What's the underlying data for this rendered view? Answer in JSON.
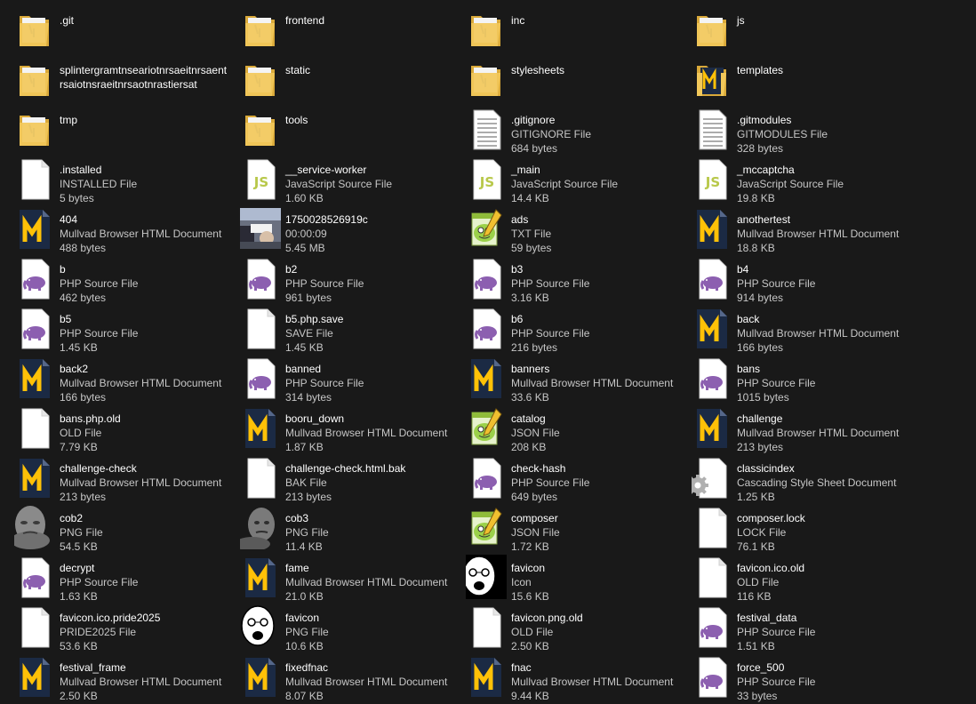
{
  "window": {
    "view": "Tiles"
  },
  "colors": {
    "background": "#191919",
    "folder": "#e8c05a",
    "mullvad_bg": "#1b2a44",
    "mullvad_m": "#ffc107",
    "php_purple": "#8c5fb0",
    "js_green": "#b8c84a"
  },
  "items": [
    {
      "name": ".git",
      "type": "",
      "size": "",
      "icon": "folder-icon",
      "kind": "folder"
    },
    {
      "name": "frontend",
      "type": "",
      "size": "",
      "icon": "folder-icon",
      "kind": "folder"
    },
    {
      "name": "inc",
      "type": "",
      "size": "",
      "icon": "folder-icon",
      "kind": "folder"
    },
    {
      "name": "js",
      "type": "",
      "size": "",
      "icon": "folder-icon",
      "kind": "folder"
    },
    {
      "name": "splintergramtnseariotnrsaeitnrsaentrsaiotnsraeitnrsaotnrastiersat",
      "type": "",
      "size": "",
      "icon": "folder-icon",
      "kind": "folder"
    },
    {
      "name": "static",
      "type": "",
      "size": "",
      "icon": "folder-icon",
      "kind": "folder"
    },
    {
      "name": "stylesheets",
      "type": "",
      "size": "",
      "icon": "folder-icon",
      "kind": "folder"
    },
    {
      "name": "templates",
      "type": "",
      "size": "",
      "icon": "folder-icon",
      "kind": "folder-m"
    },
    {
      "name": "tmp",
      "type": "",
      "size": "",
      "icon": "folder-icon",
      "kind": "folder"
    },
    {
      "name": "tools",
      "type": "",
      "size": "",
      "icon": "folder-icon",
      "kind": "folder"
    },
    {
      "name": ".gitignore",
      "type": "GITIGNORE File",
      "size": "684 bytes",
      "icon": "text-document-icon",
      "kind": "lines"
    },
    {
      "name": ".gitmodules",
      "type": "GITMODULES File",
      "size": "328 bytes",
      "icon": "text-document-icon",
      "kind": "lines"
    },
    {
      "name": ".installed",
      "type": "INSTALLED File",
      "size": "5 bytes",
      "icon": "blank-file-icon",
      "kind": "blank"
    },
    {
      "name": "__service-worker",
      "type": "JavaScript Source File",
      "size": "1.60 KB",
      "icon": "javascript-file-icon",
      "kind": "js"
    },
    {
      "name": "_main",
      "type": "JavaScript Source File",
      "size": "14.4 KB",
      "icon": "javascript-file-icon",
      "kind": "js"
    },
    {
      "name": "_mccaptcha",
      "type": "JavaScript Source File",
      "size": "19.8 KB",
      "icon": "javascript-file-icon",
      "kind": "js"
    },
    {
      "name": "404",
      "type": "Mullvad Browser HTML Document",
      "size": "488 bytes",
      "icon": "mullvad-html-icon",
      "kind": "mullvad"
    },
    {
      "name": "1750028526919c",
      "type": "00:00:09",
      "size": "5.45 MB",
      "icon": "video-thumbnail-icon",
      "kind": "video"
    },
    {
      "name": "ads",
      "type": "TXT File",
      "size": "59 bytes",
      "icon": "notepad-plus-icon",
      "kind": "npp"
    },
    {
      "name": "anothertest",
      "type": "Mullvad Browser HTML Document",
      "size": "18.8 KB",
      "icon": "mullvad-html-icon",
      "kind": "mullvad"
    },
    {
      "name": "b",
      "type": "PHP Source File",
      "size": "462 bytes",
      "icon": "php-file-icon",
      "kind": "php"
    },
    {
      "name": "b2",
      "type": "PHP Source File",
      "size": "961 bytes",
      "icon": "php-file-icon",
      "kind": "php"
    },
    {
      "name": "b3",
      "type": "PHP Source File",
      "size": "3.16 KB",
      "icon": "php-file-icon",
      "kind": "php"
    },
    {
      "name": "b4",
      "type": "PHP Source File",
      "size": "914 bytes",
      "icon": "php-file-icon",
      "kind": "php"
    },
    {
      "name": "b5",
      "type": "PHP Source File",
      "size": "1.45 KB",
      "icon": "php-file-icon",
      "kind": "php"
    },
    {
      "name": "b5.php.save",
      "type": "SAVE File",
      "size": "1.45 KB",
      "icon": "blank-file-icon",
      "kind": "blank"
    },
    {
      "name": "b6",
      "type": "PHP Source File",
      "size": "216 bytes",
      "icon": "php-file-icon",
      "kind": "php"
    },
    {
      "name": "back",
      "type": "Mullvad Browser HTML Document",
      "size": "166 bytes",
      "icon": "mullvad-html-icon",
      "kind": "mullvad"
    },
    {
      "name": "back2",
      "type": "Mullvad Browser HTML Document",
      "size": "166 bytes",
      "icon": "mullvad-html-icon",
      "kind": "mullvad"
    },
    {
      "name": "banned",
      "type": "PHP Source File",
      "size": "314 bytes",
      "icon": "php-file-icon",
      "kind": "php"
    },
    {
      "name": "banners",
      "type": "Mullvad Browser HTML Document",
      "size": "33.6 KB",
      "icon": "mullvad-html-icon",
      "kind": "mullvad"
    },
    {
      "name": "bans",
      "type": "PHP Source File",
      "size": "1015 bytes",
      "icon": "php-file-icon",
      "kind": "php"
    },
    {
      "name": "bans.php.old",
      "type": "OLD File",
      "size": "7.79 KB",
      "icon": "blank-file-icon",
      "kind": "blank"
    },
    {
      "name": "booru_down",
      "type": "Mullvad Browser HTML Document",
      "size": "1.87 KB",
      "icon": "mullvad-html-icon",
      "kind": "mullvad"
    },
    {
      "name": "catalog",
      "type": "JSON File",
      "size": "208 KB",
      "icon": "notepad-plus-icon",
      "kind": "npp"
    },
    {
      "name": "challenge",
      "type": "Mullvad Browser HTML Document",
      "size": "213 bytes",
      "icon": "mullvad-html-icon",
      "kind": "mullvad"
    },
    {
      "name": "challenge-check",
      "type": "Mullvad Browser HTML Document",
      "size": "213 bytes",
      "icon": "mullvad-html-icon",
      "kind": "mullvad"
    },
    {
      "name": "challenge-check.html.bak",
      "type": "BAK File",
      "size": "213 bytes",
      "icon": "blank-file-icon",
      "kind": "blank"
    },
    {
      "name": "check-hash",
      "type": "PHP Source File",
      "size": "649 bytes",
      "icon": "php-file-icon",
      "kind": "php"
    },
    {
      "name": "classicindex",
      "type": "Cascading Style Sheet Document",
      "size": "1.25 KB",
      "icon": "css-gear-icon",
      "kind": "css"
    },
    {
      "name": "cob2",
      "type": "PNG File",
      "size": "54.5 KB",
      "icon": "image-thumbnail-icon",
      "kind": "face"
    },
    {
      "name": "cob3",
      "type": "PNG File",
      "size": "11.4 KB",
      "icon": "image-thumbnail-icon",
      "kind": "face2"
    },
    {
      "name": "composer",
      "type": "JSON File",
      "size": "1.72 KB",
      "icon": "notepad-plus-icon",
      "kind": "npp"
    },
    {
      "name": "composer.lock",
      "type": "LOCK File",
      "size": "76.1 KB",
      "icon": "blank-file-icon",
      "kind": "blank"
    },
    {
      "name": "decrypt",
      "type": "PHP Source File",
      "size": "1.63 KB",
      "icon": "php-file-icon",
      "kind": "php"
    },
    {
      "name": "fame",
      "type": "Mullvad Browser HTML Document",
      "size": "21.0 KB",
      "icon": "mullvad-html-icon",
      "kind": "mullvad"
    },
    {
      "name": "favicon",
      "type": "Icon",
      "size": "15.6 KB",
      "icon": "soyjak-icon",
      "kind": "soy"
    },
    {
      "name": "favicon.ico.old",
      "type": "OLD File",
      "size": "116 KB",
      "icon": "blank-file-icon",
      "kind": "blank"
    },
    {
      "name": "favicon.ico.pride2025",
      "type": "PRIDE2025 File",
      "size": "53.6 KB",
      "icon": "blank-file-icon",
      "kind": "blank"
    },
    {
      "name": "favicon",
      "type": "PNG File",
      "size": "10.6 KB",
      "icon": "soyjak-icon",
      "kind": "soy2"
    },
    {
      "name": "favicon.png.old",
      "type": "OLD File",
      "size": "2.50 KB",
      "icon": "blank-file-icon",
      "kind": "blank"
    },
    {
      "name": "festival_data",
      "type": "PHP Source File",
      "size": "1.51 KB",
      "icon": "php-file-icon",
      "kind": "php"
    },
    {
      "name": "festival_frame",
      "type": "Mullvad Browser HTML Document",
      "size": "2.50 KB",
      "icon": "mullvad-html-icon",
      "kind": "mullvad"
    },
    {
      "name": "fixedfnac",
      "type": "Mullvad Browser HTML Document",
      "size": "8.07 KB",
      "icon": "mullvad-html-icon",
      "kind": "mullvad"
    },
    {
      "name": "fnac",
      "type": "Mullvad Browser HTML Document",
      "size": "9.44 KB",
      "icon": "mullvad-html-icon",
      "kind": "mullvad"
    },
    {
      "name": "force_500",
      "type": "PHP Source File",
      "size": "33 bytes",
      "icon": "php-file-icon",
      "kind": "php"
    }
  ]
}
